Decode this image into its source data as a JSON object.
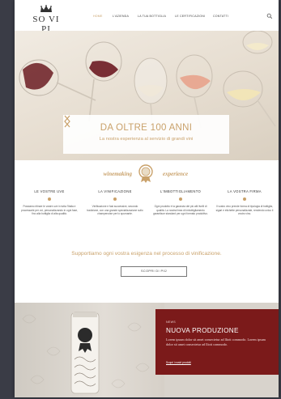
{
  "header": {
    "logo_text": "SO VI PI",
    "nav": [
      {
        "label": "HOME",
        "active": true
      },
      {
        "label": "L'AZIENDA",
        "active": false
      },
      {
        "label": "LA TUA BOTTIGLIA",
        "active": false
      },
      {
        "label": "LE CERTIFICAZIONI",
        "active": false
      },
      {
        "label": "CONTATTI",
        "active": false
      }
    ],
    "search_icon": "search-icon"
  },
  "hero": {
    "title": "DA OLTRE 100 ANNI",
    "subtitle": "La nostra esperienza al servizio di grandi vini",
    "prev_icon": "chevron-left-icon",
    "next_icon": "chevron-right-icon"
  },
  "experience": {
    "left_word": "winemaking",
    "right_word": "experience"
  },
  "features": [
    {
      "title": "LE VOSTRE UVE",
      "text": "Possiamo ritirare le vostre uve in tutta l'Italia e processarle per voi, personalizzando in ogni fase, fino alla bottiglia di alta qualità."
    },
    {
      "title": "LA VINIFICAZIONE",
      "text": "Vinificazione e fasi successive, secondo tradizione, con una grande specializzazione sullo champenoise per lo spumante."
    },
    {
      "title": "L'IMBOTTIGLIAMENTO",
      "text": "Ogni prodotto è la garanzia dei più alti livelli di qualità. La nostra linea di imbottigliamento garantisce standard per ogni formato produttivo."
    },
    {
      "title": "LA VOSTRA FIRMA",
      "text": "Il vostro vino prende forma di tipologia di bottiglia, sigari e etichette personalizzate, rendendo unico il vostro vino."
    }
  ],
  "tagline": "Supportiamo ogni vostra esigenza nel processo di vinificazione.",
  "cta_label": "SCOPRI DI PIÙ",
  "news": {
    "kicker": "NEWS",
    "title": "NUOVA PRODUZIONE",
    "text": "Lorem ipsum dolor sit amet consectetur ad lliott commodo. Lorem ipsum dolor sit amet consectetur ad lliott commodo.",
    "link": "Scopri i nostri prodotti"
  },
  "colors": {
    "accent": "#c9a16a",
    "news_bg": "#7b1a1a"
  }
}
